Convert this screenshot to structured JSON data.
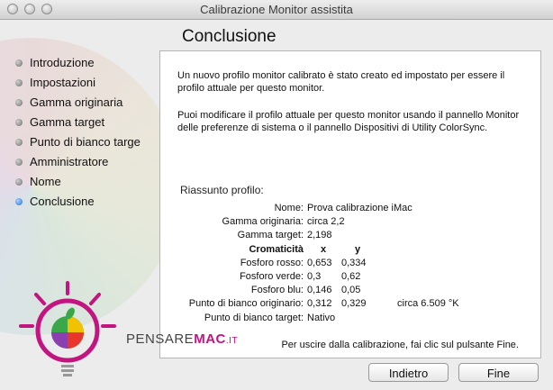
{
  "window": {
    "title": "Calibrazione Monitor assistita"
  },
  "heading": "Conclusione",
  "steps": [
    {
      "label": "Introduzione",
      "active": false
    },
    {
      "label": "Impostazioni",
      "active": false
    },
    {
      "label": "Gamma originaria",
      "active": false
    },
    {
      "label": "Gamma target",
      "active": false
    },
    {
      "label": "Punto di bianco targe",
      "active": false
    },
    {
      "label": "Amministratore",
      "active": false
    },
    {
      "label": "Nome",
      "active": false
    },
    {
      "label": "Conclusione",
      "active": true
    }
  ],
  "intro_1": "Un nuovo profilo monitor calibrato è stato creato ed impostato per essere il profilo attuale per questo monitor.",
  "intro_2": "Puoi modificare il profilo attuale per questo monitor usando il pannello Monitor delle preferenze di sistema o il pannello Dispositivi di Utility ColorSync.",
  "summary": {
    "title": "Riassunto profilo:",
    "name_label": "Nome:",
    "name_value": "Prova calibrazione iMac",
    "gamma_orig_label": "Gamma originaria:",
    "gamma_orig_value": "circa 2,2",
    "gamma_target_label": "Gamma target:",
    "gamma_target_value": "2,198",
    "chrom_label": "Cromaticità",
    "col_x": "x",
    "col_y": "y",
    "red_label": "Fosforo rosso:",
    "red_x": "0,653",
    "red_y": "0,334",
    "green_label": "Fosforo verde:",
    "green_x": "0,3",
    "green_y": "0,62",
    "blue_label": "Fosforo blu:",
    "blue_x": "0,146",
    "blue_y": "0,05",
    "wp_orig_label": "Punto di bianco originario:",
    "wp_orig_x": "0,312",
    "wp_orig_y": "0,329",
    "wp_orig_temp": "circa 6.509 °K",
    "wp_target_label": "Punto di bianco target:",
    "wp_target_value": "Nativo"
  },
  "exit_text": "Per uscire dalla calibrazione, fai clic sul pulsante Fine.",
  "buttons": {
    "back": "Indietro",
    "done": "Fine"
  },
  "brand": {
    "part1": "PENSARE",
    "part2": "MAC",
    "part3": ".IT"
  },
  "colors": {
    "brand_magenta": "#c31580",
    "active_step": "#2a6fd6"
  }
}
